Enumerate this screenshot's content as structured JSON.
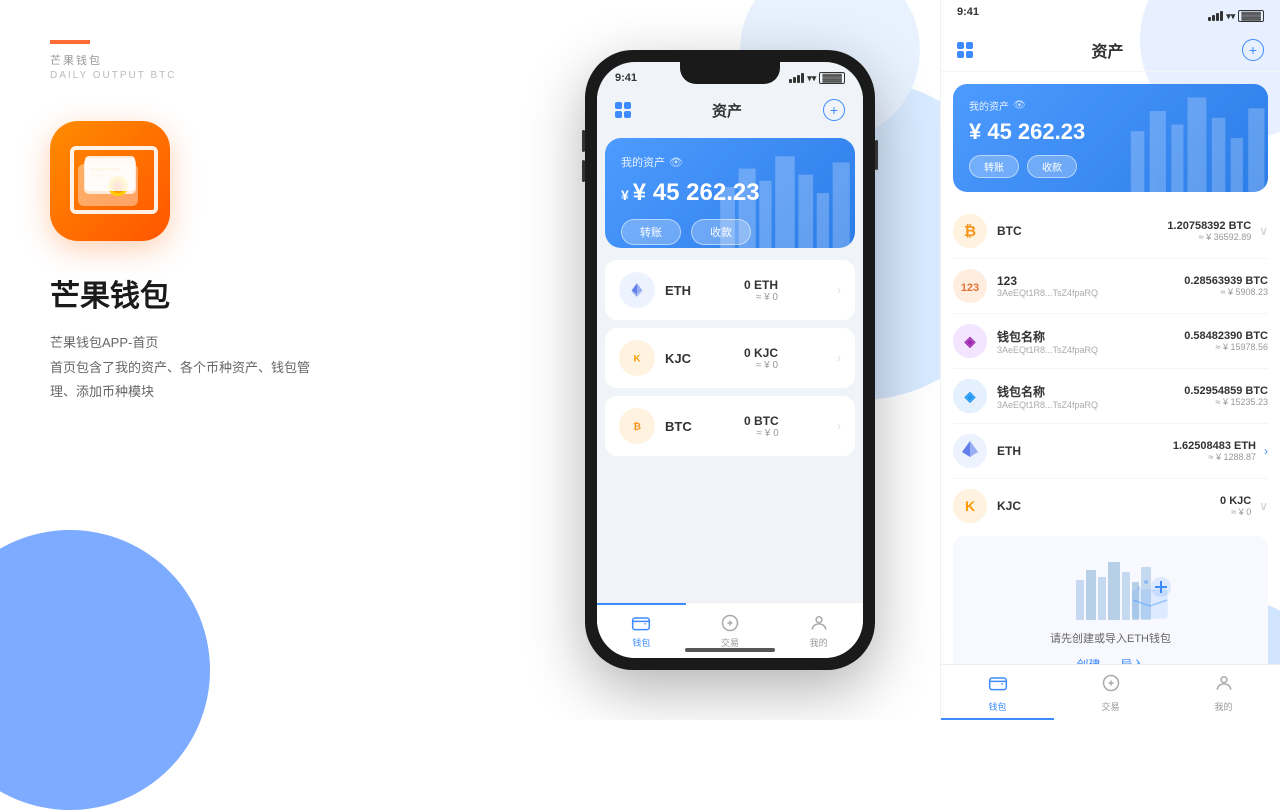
{
  "brand": {
    "line_color": "#ff6b35",
    "title": "芒果钱包",
    "subtitle": "DAILY OUTPUT BTC",
    "app_name": "芒果钱包",
    "desc_line1": "芒果钱包APP-首页",
    "desc_line2": "首页包含了我的资产、各个币种资产、钱包管",
    "desc_line3": "理、添加币种模块"
  },
  "status_bar": {
    "time": "9:41",
    "time_right": "9:41"
  },
  "phone": {
    "header_title": "资产",
    "asset_label": "我的资产",
    "asset_amount": "¥ 45 262.23",
    "transfer_btn": "转账",
    "receive_btn": "收款",
    "coins": [
      {
        "icon": "eth",
        "name": "ETH",
        "amount": "0 ETH",
        "value": "≈ ¥ 0",
        "icon_char": "◈"
      },
      {
        "icon": "kjc",
        "name": "KJC",
        "amount": "0 KJC",
        "value": "≈ ¥ 0",
        "icon_char": "⊙"
      },
      {
        "icon": "btc",
        "name": "BTC",
        "amount": "0 BTC",
        "value": "≈ ¥ 0",
        "icon_char": "₿"
      }
    ],
    "nav": [
      {
        "label": "钱包",
        "active": true
      },
      {
        "label": "交易",
        "active": false
      },
      {
        "label": "我的",
        "active": false
      }
    ]
  },
  "right": {
    "header_title": "资产",
    "asset_label": "我的资产",
    "asset_amount": "¥ 45 262.23",
    "transfer_btn": "转账",
    "receive_btn": "收款",
    "coins": [
      {
        "type": "btc",
        "name": "BTC",
        "addr": "",
        "amount": "1.20758392 BTC",
        "fiat": "≈ ¥ 36592.89"
      },
      {
        "type": "c123",
        "name": "123",
        "addr": "3AeEQt1R8...TsZ4fpaRQ",
        "amount": "0.28563939 BTC",
        "fiat": "≈ ¥ 5908.23"
      },
      {
        "type": "wallet-p",
        "name": "钱包名称",
        "addr": "3AeEQt1R8...TsZ4fpaRQ",
        "amount": "0.58482390 BTC",
        "fiat": "≈ ¥ 15978.56"
      },
      {
        "type": "wallet-b",
        "name": "钱包名称",
        "addr": "3AeEQt1R8...TsZ4fpaRQ",
        "amount": "0.52954859 BTC",
        "fiat": "≈ ¥ 15235.23"
      },
      {
        "type": "eth",
        "name": "ETH",
        "addr": "",
        "amount": "1.62508483 ETH",
        "fiat": "≈ ¥ 1288.87"
      },
      {
        "type": "kjc",
        "name": "KJC",
        "addr": "",
        "amount": "0 KJC",
        "fiat": "≈ ¥ 0"
      }
    ],
    "eth_import_text": "请先创建或导入ETH钱包",
    "create_btn": "创建",
    "import_btn": "导入",
    "nav": [
      {
        "label": "钱包",
        "active": true
      },
      {
        "label": "交易",
        "active": false
      },
      {
        "label": "我的",
        "active": false
      }
    ]
  }
}
